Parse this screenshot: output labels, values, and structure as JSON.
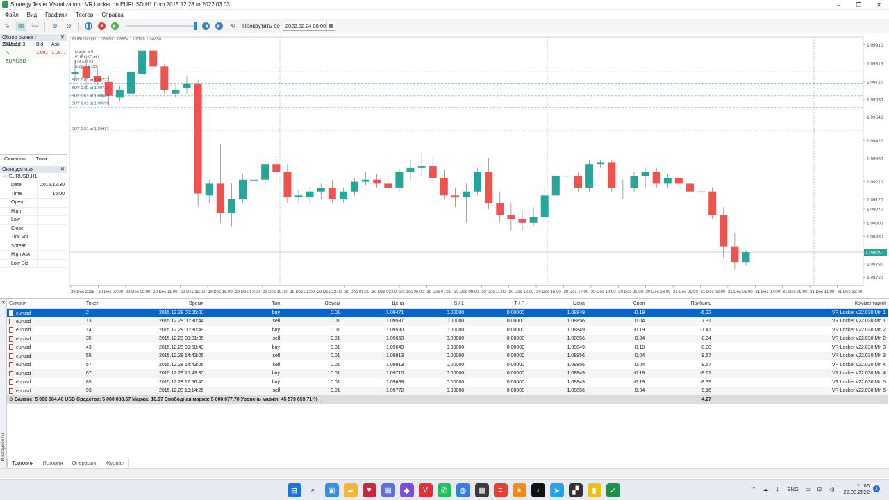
{
  "window": {
    "title": "Strategy Tester Visualization : VR Locker on EURUSD,H1 from 2015.12.28 to 2022.03.03",
    "controls": [
      "–",
      "❐",
      "✕"
    ]
  },
  "menu": [
    "Файл",
    "Вид",
    "Графики",
    "Тестер",
    "Справка"
  ],
  "toolbar": {
    "scroll_label": "Прокрутить до",
    "scroll_date": "2022.02.24 00:00"
  },
  "market_watch": {
    "title": "Обзор рынка : 2015.12.3",
    "columns": [
      "Символ",
      "Bid",
      "Ask"
    ],
    "rows": [
      {
        "symbol": "EURUSD",
        "bid": "1.08...",
        "ask": "1.08..."
      }
    ],
    "tabs": [
      "Символы",
      "Тики"
    ]
  },
  "data_window": {
    "title": "Окно данных",
    "symbol": "EURUSD,H1",
    "rows": [
      {
        "k": "Date",
        "v": "2015.12.30"
      },
      {
        "k": "Time",
        "v": "16:00"
      },
      {
        "k": "Open",
        "v": ""
      },
      {
        "k": "High",
        "v": ""
      },
      {
        "k": "Low",
        "v": ""
      },
      {
        "k": "Close",
        "v": ""
      },
      {
        "k": "Tick Vol...",
        "v": ""
      },
      {
        "k": "Spread",
        "v": ""
      },
      {
        "k": "High Ask",
        "v": ""
      },
      {
        "k": "Low Bid",
        "v": ""
      }
    ]
  },
  "chart": {
    "header": "EURUSD,H1  1.08829 1.08854 1.08788 1.08850",
    "overlay_lines": [
      "Magic = 5",
      "EURUSD-H1 ...",
      "Lot = 0.01",
      "Step = 5.00"
    ],
    "order_labels": [
      "BUY 0.01 at 1.09772",
      "BUY 0.01 at 1.09710",
      "BUY 0.01 at 1.09649",
      "BUY 0.01 at 1.09590",
      "BUY 0.01 at 1.09471"
    ],
    "current_price": "1.08850",
    "colors": {
      "bull": "#26a69a",
      "bear": "#ef5350",
      "price": "#26a69a"
    }
  },
  "chart_data": {
    "type": "candlestick",
    "y_ticks": [
      "1.09910",
      "1.09815",
      "1.09720",
      "1.09630",
      "1.09540",
      "1.09420",
      "1.09330",
      "1.09210",
      "1.09120",
      "1.09070",
      "1.09000",
      "1.08930",
      "1.08850",
      "1.08790",
      "1.08720"
    ],
    "ylim": [
      1.0868,
      1.0995
    ],
    "x_ticks": [
      "29 Dec 2015",
      "29 Dec 07:00",
      "29 Dec 09:00",
      "29 Dec 11:00",
      "29 Dec 13:00",
      "29 Dec 15:00",
      "29 Dec 17:00",
      "29 Dec 19:00",
      "29 Dec 21:00",
      "29 Dec 23:00",
      "30 Dec 01:00",
      "30 Dec 03:00",
      "30 Dec 05:00",
      "30 Dec 07:00",
      "30 Dec 09:00",
      "30 Dec 11:00",
      "30 Dec 13:00",
      "30 Dec 15:00",
      "30 Dec 17:00",
      "30 Dec 19:00",
      "30 Dec 21:00",
      "30 Dec 23:00",
      "31 Dec 01:00",
      "31 Dec 03:00",
      "31 Dec 05:00",
      "31 Dec 07:00",
      "31 Dec 09:00",
      "31 Dec 11:00",
      "31 Dec 13:00"
    ],
    "candles": [
      {
        "o": 1.0976,
        "h": 1.0983,
        "l": 1.0973,
        "c": 1.0977
      },
      {
        "o": 1.098,
        "h": 1.0984,
        "l": 1.0968,
        "c": 1.0974
      },
      {
        "o": 1.0975,
        "h": 1.098,
        "l": 1.097,
        "c": 1.0972
      },
      {
        "o": 1.0972,
        "h": 1.0975,
        "l": 1.096,
        "c": 1.0965
      },
      {
        "o": 1.0964,
        "h": 1.097,
        "l": 1.0962,
        "c": 1.0968
      },
      {
        "o": 1.0966,
        "h": 1.0978,
        "l": 1.0964,
        "c": 1.0977
      },
      {
        "o": 1.0976,
        "h": 1.0991,
        "l": 1.0974,
        "c": 1.0988
      },
      {
        "o": 1.0988,
        "h": 1.0992,
        "l": 1.0978,
        "c": 1.098
      },
      {
        "o": 1.098,
        "h": 1.0981,
        "l": 1.0966,
        "c": 1.0968
      },
      {
        "o": 1.0966,
        "h": 1.097,
        "l": 1.0964,
        "c": 1.0968
      },
      {
        "o": 1.0969,
        "h": 1.0975,
        "l": 1.0966,
        "c": 1.0971
      },
      {
        "o": 1.0971,
        "h": 1.0973,
        "l": 1.0908,
        "c": 1.0915
      },
      {
        "o": 1.0914,
        "h": 1.0922,
        "l": 1.091,
        "c": 1.092
      },
      {
        "o": 1.092,
        "h": 1.094,
        "l": 1.09,
        "c": 1.0905
      },
      {
        "o": 1.0905,
        "h": 1.092,
        "l": 1.0898,
        "c": 1.0912
      },
      {
        "o": 1.0912,
        "h": 1.0925,
        "l": 1.091,
        "c": 1.0922
      },
      {
        "o": 1.0922,
        "h": 1.0926,
        "l": 1.0918,
        "c": 1.0922
      },
      {
        "o": 1.0922,
        "h": 1.0932,
        "l": 1.092,
        "c": 1.093
      },
      {
        "o": 1.093,
        "h": 1.0934,
        "l": 1.0922,
        "c": 1.0926
      },
      {
        "o": 1.0926,
        "h": 1.093,
        "l": 1.091,
        "c": 1.0913
      },
      {
        "o": 1.0913,
        "h": 1.0917,
        "l": 1.091,
        "c": 1.0914
      },
      {
        "o": 1.0913,
        "h": 1.0918,
        "l": 1.091,
        "c": 1.0916
      },
      {
        "o": 1.0916,
        "h": 1.092,
        "l": 1.0912,
        "c": 1.0918
      },
      {
        "o": 1.0918,
        "h": 1.0922,
        "l": 1.091,
        "c": 1.0912
      },
      {
        "o": 1.0912,
        "h": 1.0918,
        "l": 1.091,
        "c": 1.0916
      },
      {
        "o": 1.0916,
        "h": 1.0923,
        "l": 1.0914,
        "c": 1.0921
      },
      {
        "o": 1.0921,
        "h": 1.0926,
        "l": 1.0919,
        "c": 1.0922
      },
      {
        "o": 1.0922,
        "h": 1.0925,
        "l": 1.0918,
        "c": 1.092
      },
      {
        "o": 1.092,
        "h": 1.0924,
        "l": 1.0916,
        "c": 1.0918
      },
      {
        "o": 1.0918,
        "h": 1.0928,
        "l": 1.0916,
        "c": 1.0926
      },
      {
        "o": 1.0926,
        "h": 1.0932,
        "l": 1.0922,
        "c": 1.0928
      },
      {
        "o": 1.0928,
        "h": 1.0936,
        "l": 1.0924,
        "c": 1.0929
      },
      {
        "o": 1.0929,
        "h": 1.0933,
        "l": 1.092,
        "c": 1.0923
      },
      {
        "o": 1.0923,
        "h": 1.0927,
        "l": 1.0912,
        "c": 1.0914
      },
      {
        "o": 1.0914,
        "h": 1.0918,
        "l": 1.0908,
        "c": 1.0913
      },
      {
        "o": 1.0913,
        "h": 1.092,
        "l": 1.09,
        "c": 1.0916
      },
      {
        "o": 1.0916,
        "h": 1.0928,
        "l": 1.0914,
        "c": 1.0926
      },
      {
        "o": 1.0926,
        "h": 1.0933,
        "l": 1.0907,
        "c": 1.091
      },
      {
        "o": 1.091,
        "h": 1.0916,
        "l": 1.09,
        "c": 1.0904
      },
      {
        "o": 1.0904,
        "h": 1.091,
        "l": 1.0896,
        "c": 1.0902
      },
      {
        "o": 1.0902,
        "h": 1.0906,
        "l": 1.0896,
        "c": 1.09
      },
      {
        "o": 1.09,
        "h": 1.0908,
        "l": 1.0898,
        "c": 1.0903
      },
      {
        "o": 1.0903,
        "h": 1.0918,
        "l": 1.0901,
        "c": 1.0914
      },
      {
        "o": 1.0914,
        "h": 1.093,
        "l": 1.0912,
        "c": 1.0924
      },
      {
        "o": 1.0924,
        "h": 1.0928,
        "l": 1.092,
        "c": 1.0924
      },
      {
        "o": 1.0924,
        "h": 1.0926,
        "l": 1.0916,
        "c": 1.0918
      },
      {
        "o": 1.0918,
        "h": 1.0932,
        "l": 1.0916,
        "c": 1.093
      },
      {
        "o": 1.093,
        "h": 1.0932,
        "l": 1.0928,
        "c": 1.0931
      },
      {
        "o": 1.0931,
        "h": 1.0932,
        "l": 1.0916,
        "c": 1.0918
      },
      {
        "o": 1.0918,
        "h": 1.0922,
        "l": 1.0912,
        "c": 1.0918
      },
      {
        "o": 1.0918,
        "h": 1.0926,
        "l": 1.0916,
        "c": 1.0924
      },
      {
        "o": 1.0924,
        "h": 1.0928,
        "l": 1.0918,
        "c": 1.0926
      },
      {
        "o": 1.0926,
        "h": 1.0928,
        "l": 1.0918,
        "c": 1.092
      },
      {
        "o": 1.092,
        "h": 1.0925,
        "l": 1.0918,
        "c": 1.0923
      },
      {
        "o": 1.0923,
        "h": 1.0926,
        "l": 1.0918,
        "c": 1.092
      },
      {
        "o": 1.092,
        "h": 1.0925,
        "l": 1.0914,
        "c": 1.0916
      },
      {
        "o": 1.0916,
        "h": 1.0923,
        "l": 1.0914,
        "c": 1.0916
      },
      {
        "o": 1.0916,
        "h": 1.0918,
        "l": 1.0902,
        "c": 1.0904
      },
      {
        "o": 1.0904,
        "h": 1.0908,
        "l": 1.0882,
        "c": 1.0888
      },
      {
        "o": 1.0888,
        "h": 1.0895,
        "l": 1.0876,
        "c": 1.088
      },
      {
        "o": 1.088,
        "h": 1.0886,
        "l": 1.0878,
        "c": 1.0885
      }
    ]
  },
  "positions": {
    "columns": [
      "Символ",
      "Тикет",
      "Время",
      "Тип",
      "Объем",
      "Цена",
      "S / L",
      "T / P",
      "Цена",
      "Своп",
      "Прибыль",
      "Комментарий"
    ],
    "rows": [
      [
        "eurusd",
        "2",
        "2015.12.28 00:05:00",
        "buy",
        "0.01",
        "1.09471",
        "0.00000",
        "0.00000",
        "1.08849",
        "-0.19",
        "-6.22",
        "VR Locker v22.030 Mn 1"
      ],
      [
        "eurusd",
        "13",
        "2015.12.28 00:30:44",
        "sell",
        "0.01",
        "1.09587",
        "0.00000",
        "0.00000",
        "1.08856",
        "0.04",
        "7.31",
        "VR Locker v22.030 Mn 1"
      ],
      [
        "eurusd",
        "14",
        "2015.12.28 00:30:49",
        "buy",
        "0.01",
        "1.09590",
        "0.00000",
        "0.00000",
        "1.08849",
        "-0.19",
        "-7.41",
        "VR Locker v22.030 Mn 2"
      ],
      [
        "eurusd",
        "35",
        "2015.12.28 09:01:05",
        "sell",
        "0.01",
        "1.09660",
        "0.00000",
        "0.00000",
        "1.08856",
        "0.04",
        "8.04",
        "VR Locker v22.030 Mn 2"
      ],
      [
        "eurusd",
        "43",
        "2015.12.28 09:58:43",
        "buy",
        "0.01",
        "1.09649",
        "0.00000",
        "0.00000",
        "1.08849",
        "-0.19",
        "-8.00",
        "VR Locker v22.030 Mn 3"
      ],
      [
        "eurusd",
        "55",
        "2015.12.28 14:43:05",
        "sell",
        "0.01",
        "1.09813",
        "0.00000",
        "0.00000",
        "1.08856",
        "0.04",
        "9.57",
        "VR Locker v22.030 Mn 3"
      ],
      [
        "eurusd",
        "57",
        "2015.12.28 14:43:06",
        "sell",
        "0.01",
        "1.09813",
        "0.00000",
        "0.00000",
        "1.08856",
        "0.04",
        "9.57",
        "VR Locker v22.030 Mn 4"
      ],
      [
        "eurusd",
        "67",
        "2015.12.28 15:43:30",
        "buy",
        "0.01",
        "1.09710",
        "0.00000",
        "0.00000",
        "1.08849",
        "-0.19",
        "-8.61",
        "VR Locker v22.030 Mn 4"
      ],
      [
        "eurusd",
        "85",
        "2015.12.28 17:56:40",
        "buy",
        "0.01",
        "1.09688",
        "0.00000",
        "0.00000",
        "1.08849",
        "-0.19",
        "-8.39",
        "VR Locker v22.030 Mn 5"
      ],
      [
        "eurusd",
        "93",
        "2015.12.28 19:14:26",
        "sell",
        "0.01",
        "1.09772",
        "0.00000",
        "0.00000",
        "1.08856",
        "0.04",
        "9.16",
        "VR Locker v22.030 Mn 5"
      ]
    ],
    "summary": "Баланс: 5 000 084.40 USD  Средства: 5 000 088.67  Маржа: 10.97  Свободная маржа: 5 000 077.70  Уровень маржи: 45 579 659.71 %",
    "summary_profit": "4.27"
  },
  "terminal": {
    "side_label": "Инструменты",
    "tabs": [
      "Торговля",
      "История",
      "Операции",
      "Журнал"
    ]
  },
  "taskbar": {
    "tray_lang": "ENG",
    "time": "11:06",
    "date": "22.03.2022"
  }
}
